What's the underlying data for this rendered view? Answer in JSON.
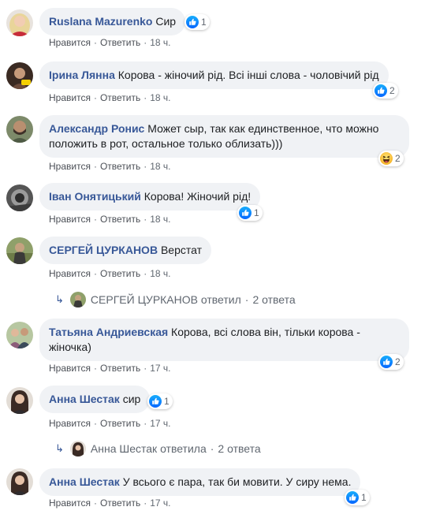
{
  "colors": {
    "link": "#385898",
    "bubble": "#f0f2f5",
    "like": "#2078f4",
    "meta": "#606770"
  },
  "comments": [
    {
      "name": "Ruslana Mazurenko",
      "text": "Сир",
      "like_label": "Нравится",
      "reply_label": "Ответить",
      "time": "18 ч.",
      "reaction": {
        "icon": "like-icon",
        "count": "1"
      }
    },
    {
      "name": "Ірина Лянна",
      "text": "Корова - жіночий рід. Всі інші слова - чоловічий рід",
      "like_label": "Нравится",
      "reply_label": "Ответить",
      "time": "18 ч.",
      "reaction": {
        "icon": "like-icon",
        "count": "2"
      }
    },
    {
      "name": "Александр Ронис",
      "text": "Может сыр, так как единственное, что можно положить в рот, остальное только облизать)))",
      "like_label": "Нравится",
      "reply_label": "Ответить",
      "time": "18 ч.",
      "reaction": {
        "icon": "haha-icon",
        "count": "2"
      }
    },
    {
      "name": "Іван Онятицький",
      "text": "Корова! Жіночий рід!",
      "like_label": "Нравится",
      "reply_label": "Ответить",
      "time": "18 ч.",
      "reaction": {
        "icon": "like-icon",
        "count": "1"
      }
    },
    {
      "name": "СЕРГЕЙ ЦУРКАНОВ",
      "text": "Верстат",
      "like_label": "Нравится",
      "reply_label": "Ответить",
      "time": "18 ч.",
      "replies": {
        "author": "СЕРГЕЙ ЦУРКАНОВ",
        "verb": "ответил",
        "count": "2 ответа"
      }
    },
    {
      "name": "Татьяна Андриевская",
      "text": "Корова, всі слова він, тільки корова - жіночка)",
      "like_label": "Нравится",
      "reply_label": "Ответить",
      "time": "17 ч.",
      "reaction": {
        "icon": "like-icon",
        "count": "2"
      }
    },
    {
      "name": "Анна Шестак",
      "text": "сир",
      "like_label": "Нравится",
      "reply_label": "Ответить",
      "time": "17 ч.",
      "reaction": {
        "icon": "like-icon",
        "count": "1"
      },
      "replies": {
        "author": "Анна Шестак",
        "verb": "ответила",
        "count": "2 ответа"
      }
    },
    {
      "name": "Анна Шестак",
      "text": "У всього є пара, так би мовити. У сиру нема.",
      "like_label": "Нравится",
      "reply_label": "Ответить",
      "time": "17 ч.",
      "reaction": {
        "icon": "like-icon",
        "count": "1"
      }
    }
  ]
}
